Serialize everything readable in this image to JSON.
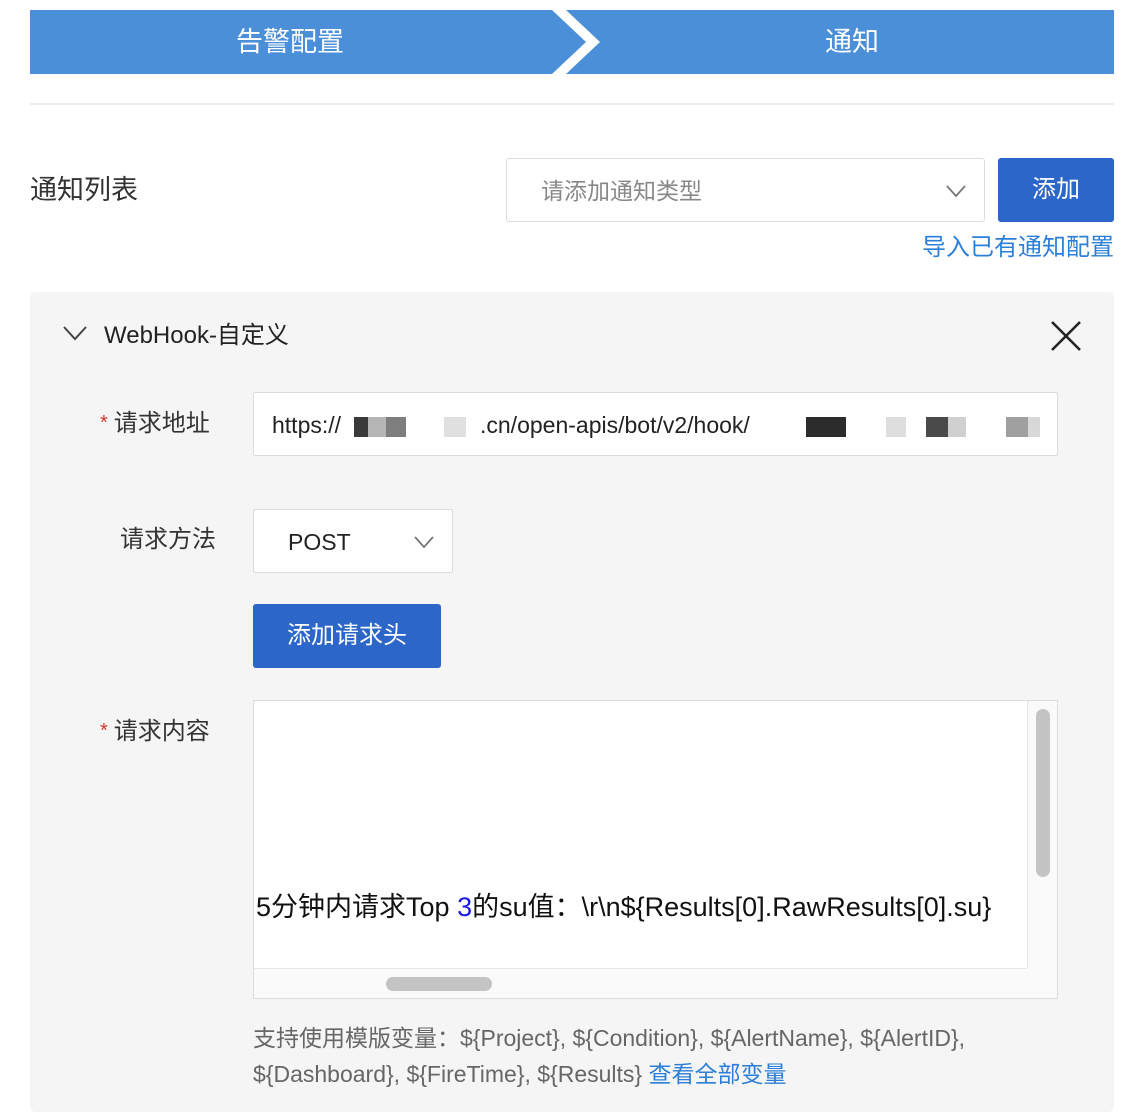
{
  "steps": [
    {
      "label": "告警配置"
    },
    {
      "label": "通知"
    }
  ],
  "colors": {
    "step_bg": "#4a8fd8",
    "primary": "#2b66c8",
    "link": "#2b7fd8",
    "required": "#d9372b"
  },
  "notification_list": {
    "title": "通知列表",
    "type_select_placeholder": "请添加通知类型",
    "add_button": "添加",
    "import_link": "导入已有通知配置"
  },
  "webhook_panel": {
    "title": "WebHook-自定义",
    "url_label": "请求地址",
    "url_prefix": "https://",
    "url_visible_part": ".cn/open-apis/bot/v2/hook/",
    "method_label": "请求方法",
    "method_value": "POST",
    "add_header_button": "添加请求头",
    "content_label": "请求内容",
    "content_line_before": "5分钟内请求Top ",
    "content_line_num": "3",
    "content_line_after": "的su值：\\r\\n${Results[0].RawResults[0].su} ",
    "help_text": "支持使用模版变量：${Project}, ${Condition}, ${AlertName}, ${AlertID}, ${Dashboard}, ${FireTime}, ${Results}",
    "help_link": "查看全部变量"
  },
  "icons": [
    "chevron-down-icon",
    "close-icon"
  ]
}
